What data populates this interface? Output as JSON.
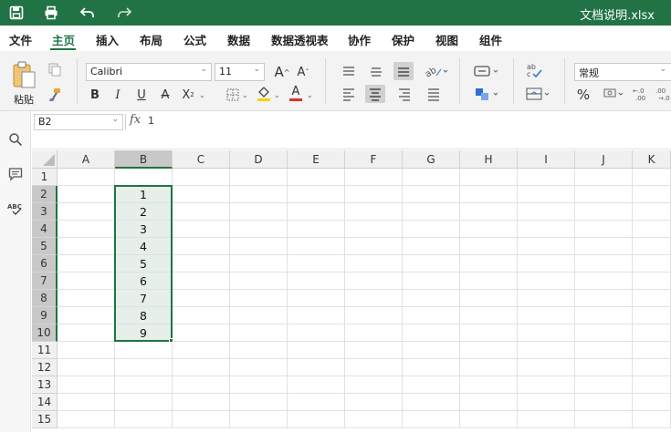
{
  "window": {
    "title": "文档说明.xlsx",
    "icons": [
      "save-icon",
      "print-icon",
      "undo-icon",
      "redo-icon"
    ]
  },
  "menu": {
    "items": [
      "文件",
      "主页",
      "插入",
      "布局",
      "公式",
      "数据",
      "数据透视表",
      "协作",
      "保护",
      "视图",
      "组件"
    ],
    "active_index": 1
  },
  "ribbon": {
    "paste_label": "粘贴",
    "font_name": "Calibri",
    "font_size": "11",
    "number_format": "常规",
    "bold_glyph": "B",
    "italic_glyph": "I",
    "underline_glyph": "U",
    "strike_glyph": "A",
    "subscript_glyph": "X",
    "grow_glyph": "A",
    "shrink_glyph": "A",
    "font_color_glyph": "A",
    "percent_glyph": "%",
    "accent_color": "#217346",
    "font_color_bar": "#e03030",
    "highlight_color_bar": "#f5d500"
  },
  "formula_bar": {
    "name_box": "B2",
    "fx_label": "fx",
    "formula": "1"
  },
  "grid": {
    "columns": [
      "A",
      "B",
      "C",
      "D",
      "E",
      "F",
      "G",
      "H",
      "I",
      "J",
      "K"
    ],
    "rows": [
      "1",
      "2",
      "3",
      "4",
      "5",
      "6",
      "7",
      "8",
      "9",
      "10",
      "11",
      "12",
      "13",
      "14",
      "15"
    ],
    "selected_column": "B",
    "selected_rows": [
      "2",
      "3",
      "4",
      "5",
      "6",
      "7",
      "8",
      "9",
      "10"
    ],
    "column_b_values": [
      "",
      "1",
      "2",
      "3",
      "4",
      "5",
      "6",
      "7",
      "8",
      "9",
      "",
      "",
      "",
      "",
      ""
    ]
  }
}
